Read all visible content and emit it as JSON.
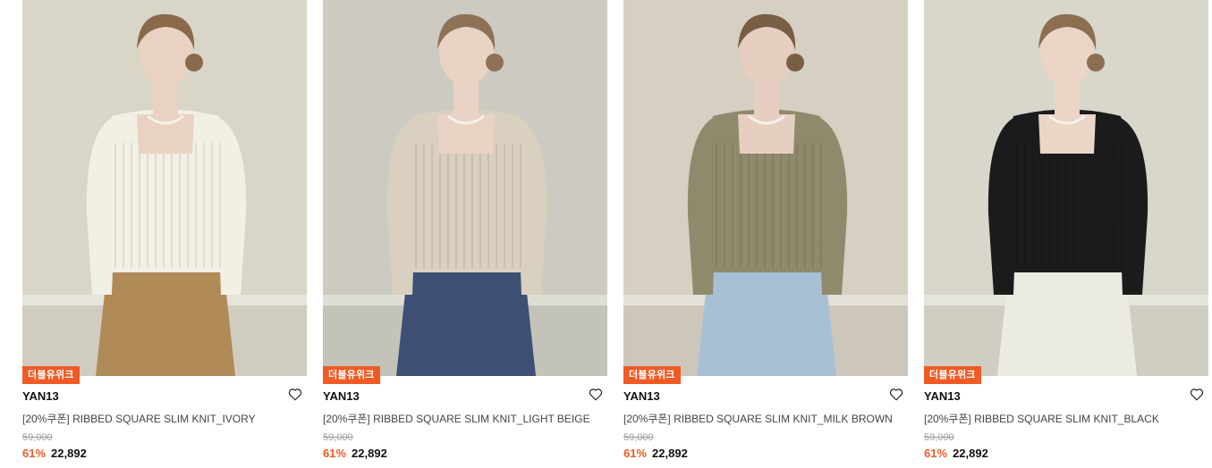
{
  "products": [
    {
      "badge": "더블유위크",
      "brand": "YAN13",
      "name": "[20%쿠폰] RIBBED SQUARE SLIM KNIT_IVORY",
      "original_price": "59,000",
      "discount": "61%",
      "sale_price": "22,892",
      "colors": {
        "bg": "#d9d6c8",
        "knit": "#f2efe4",
        "bottom": "#b08a57",
        "skin": "#e9d2c2",
        "hair": "#8a6a4a"
      }
    },
    {
      "badge": "더블유위크",
      "brand": "YAN13",
      "name": "[20%쿠폰] RIBBED SQUARE SLIM KNIT_LIGHT BEIGE",
      "original_price": "59,000",
      "discount": "61%",
      "sale_price": "22,892",
      "colors": {
        "bg": "#cdcbc1",
        "knit": "#d9d0c0",
        "bottom": "#3d4f73",
        "skin": "#e8d3c5",
        "hair": "#8f7255"
      }
    },
    {
      "badge": "더블유위크",
      "brand": "YAN13",
      "name": "[20%쿠폰] RIBBED SQUARE SLIM KNIT_MILK BROWN",
      "original_price": "59,000",
      "discount": "61%",
      "sale_price": "22,892",
      "colors": {
        "bg": "#d5d0c2",
        "knit": "#8f8a6c",
        "bottom": "#a8c0d6",
        "skin": "#e6cfc0",
        "hair": "#7a5e44"
      }
    },
    {
      "badge": "더블유위크",
      "brand": "YAN13",
      "name": "[20%쿠폰] RIBBED SQUARE SLIM KNIT_BLACK",
      "original_price": "59,000",
      "discount": "61%",
      "sale_price": "22,892",
      "colors": {
        "bg": "#d9d7cb",
        "knit": "#1b1b1b",
        "bottom": "#ecebe3",
        "skin": "#ead5c7",
        "hair": "#8c6e50"
      }
    }
  ],
  "accent_color": "#f15a24",
  "icons": {
    "wishlist": "heart-outline-icon"
  }
}
